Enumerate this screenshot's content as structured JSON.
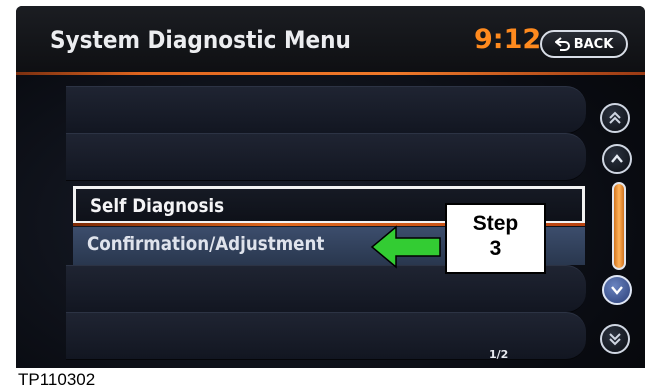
{
  "header": {
    "title": "System Diagnostic Menu",
    "clock": "9:12",
    "back_label": "BACK"
  },
  "menu": {
    "items": [
      {
        "label": "Self Diagnosis",
        "state": "focused"
      },
      {
        "label": "Confirmation/Adjustment",
        "state": "highlighted"
      }
    ]
  },
  "scrollbar": {
    "page_indicator": "1/2",
    "icons": [
      "page-up-icon",
      "scroll-up-icon",
      "scroll-down-icon",
      "page-down-icon"
    ]
  },
  "annotation": {
    "step_label": "Step",
    "step_number": "3",
    "arrow_color": "#33cc33"
  },
  "caption": "TP110302",
  "colors": {
    "accent": "#f07a2a",
    "clock": "#ff8a1e",
    "highlight_row": "#34445f"
  }
}
